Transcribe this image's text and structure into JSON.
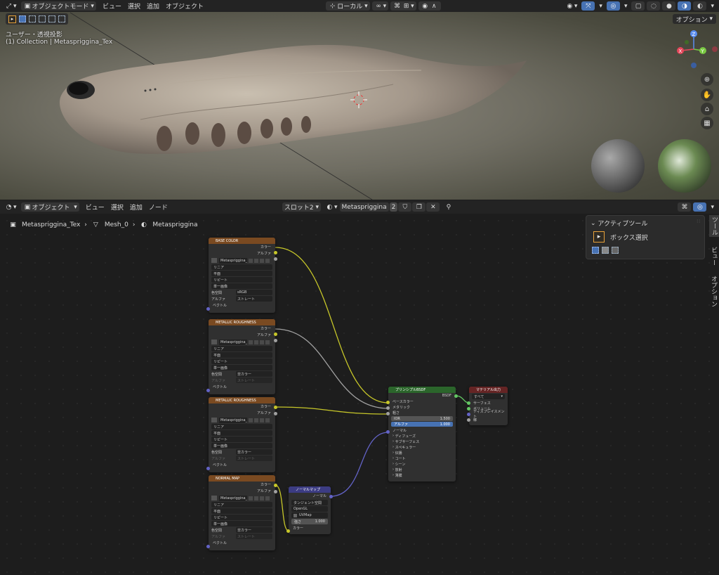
{
  "viewport": {
    "mode": "オブジェクトモード",
    "menus": [
      "ビュー",
      "選択",
      "追加",
      "オブジェクト"
    ],
    "transform_orientation": "ローカル",
    "view_name": "ユーザー・透視投影",
    "collection_info": "(1) Collection | Metaspriggina_Tex",
    "options_label": "オプション",
    "gizmo_axes": {
      "x": "X",
      "y": "Y",
      "z": "Z"
    },
    "nav_icons": [
      "zoom-icon",
      "hand-icon",
      "camera-icon",
      "grid-icon"
    ]
  },
  "node_editor": {
    "mode": "オブジェクト",
    "menus": [
      "ビュー",
      "選択",
      "追加",
      "ノード"
    ],
    "slot": "スロット2",
    "material_name": "Metaspriggina",
    "user_count": "2",
    "breadcrumb": [
      "Metaspriggina_Tex",
      "Mesh_0",
      "Metaspriggina"
    ]
  },
  "side_panel": {
    "title": "アクティブツール",
    "tool_name": "ボックス選択",
    "tabs": [
      "ツール",
      "ビュー",
      "オプション"
    ]
  },
  "nodes": {
    "base_color": {
      "title": "BASE COLOR",
      "outputs": [
        "カラー",
        "アルファ"
      ],
      "image": "Metaspriggina_...",
      "fields": [
        "リニア",
        "平面",
        "リピート",
        "単一画像"
      ],
      "colorspace_label": "色空間",
      "colorspace": "sRGB",
      "alpha_label": "アルファ",
      "alpha": "ストレート",
      "vector": "ベクトル"
    },
    "metallic1": {
      "title": "METALLIC ROUGHNESS",
      "outputs": [
        "カラー",
        "アルファ"
      ],
      "image": "Metaspriggina_...",
      "fields": [
        "リニア",
        "平面",
        "リピート",
        "単一画像"
      ],
      "colorspace_label": "色空間",
      "colorspace": "非カラー",
      "alpha_label": "アルファ",
      "alpha": "ストレート",
      "vector": "ベクトル"
    },
    "metallic2": {
      "title": "METALLIC ROUGHNESS",
      "outputs": [
        "カラー",
        "アルファ"
      ],
      "image": "Metaspriggina_...",
      "fields": [
        "リニア",
        "平面",
        "リピート",
        "単一画像"
      ],
      "colorspace_label": "色空間",
      "colorspace": "非カラー",
      "alpha_label": "アルファ",
      "alpha": "ストレート",
      "vector": "ベクトル"
    },
    "normal_tex": {
      "title": "NORMAL MAP",
      "outputs": [
        "カラー",
        "アルファ"
      ],
      "image": "Metaspriggina_...",
      "fields": [
        "リニア",
        "平面",
        "リピート",
        "単一画像"
      ],
      "colorspace_label": "色空間",
      "colorspace": "非カラー",
      "alpha_label": "アルファ",
      "alpha": "ストレート",
      "vector": "ベクトル"
    },
    "normal_map": {
      "title": "ノーマルマップ",
      "output": "ノーマル",
      "space": "タンジェント空間",
      "convention": "OpenGL",
      "uv": "UVMap",
      "strength_label": "強さ",
      "strength": "1.000",
      "color": "カラー"
    },
    "bsdf": {
      "title": "プリンシプルBSDF",
      "output": "BSDF",
      "inputs": [
        "ベースカラー",
        "メタリック",
        "粗さ"
      ],
      "ior_label": "IOR",
      "ior": "1.500",
      "alpha_label": "アルファ",
      "alpha": "1.000",
      "normal": "ノーマル",
      "panels": [
        "ディフューズ",
        "サブサーフェス",
        "スペキュラー",
        "伝播",
        "コート",
        "シーン",
        "放射",
        "薄膜"
      ]
    },
    "output": {
      "title": "マテリアル出力",
      "target": "すべて",
      "inputs": [
        "サーフェス",
        "ボリューム",
        "ディスプレイスメント",
        "稼"
      ]
    }
  },
  "colors": {
    "texture_header": "#7a4a21",
    "vector_header": "#3c3c83",
    "shader_header": "#2b652b",
    "output_header": "#652424",
    "link_color": "#c7c729",
    "link_gray": "#a1a1a1",
    "link_vector": "#6363c7",
    "accent": "#4772b3"
  }
}
